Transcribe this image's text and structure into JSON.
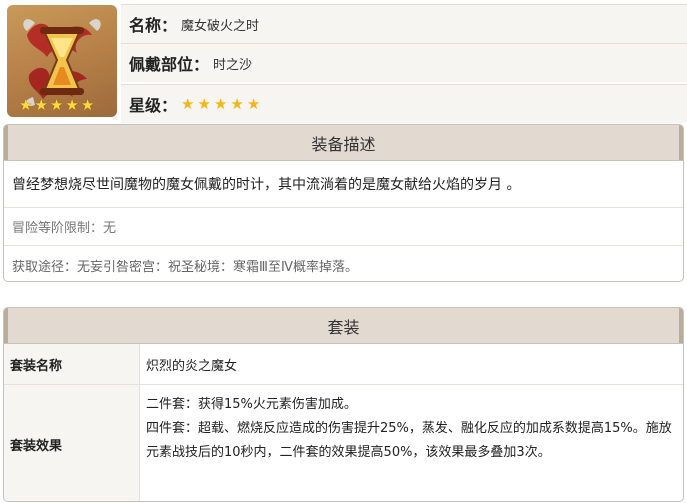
{
  "artifact": {
    "icon_name": "hourglass-artifact-icon",
    "icon_stars": [
      "★",
      "★",
      "★",
      "★",
      "★"
    ],
    "name_label": "名称：",
    "name_value": "魔女破火之时",
    "slot_label": "佩戴部位：",
    "slot_value": "时之沙",
    "rarity_label": "星级：",
    "rarity_stars": [
      "★",
      "★",
      "★",
      "★",
      "★"
    ],
    "rarity_value": 5
  },
  "description": {
    "title": "装备描述",
    "text": "曾经梦想烧尽世间魔物的魔女佩戴的时计，其中流淌着的是魔女献给火焰的岁月 。",
    "rank_limit": "冒险等阶限制：无",
    "source": "获取途径：无妄引咎密宫：祝圣秘境：寒霜Ⅲ至Ⅳ概率掉落。"
  },
  "set": {
    "title": "套装",
    "name_key": "套装名称",
    "name_value": "炽烈的炎之魔女",
    "effect_key": "套装效果",
    "effect_2pc": "二件套：获得15%火元素伤害加成。",
    "effect_4pc": "四件套：超载、燃烧反应造成的伤害提升25%，蒸发、融化反应的加成系数提高15%。施放元素战技后的10秒内，二件套的效果提高50%，该效果最多叠加3次。"
  },
  "colors": {
    "header_bg": "#e2dad1",
    "star_gold": "#f4b616",
    "icon_bg": "#b9834a"
  }
}
